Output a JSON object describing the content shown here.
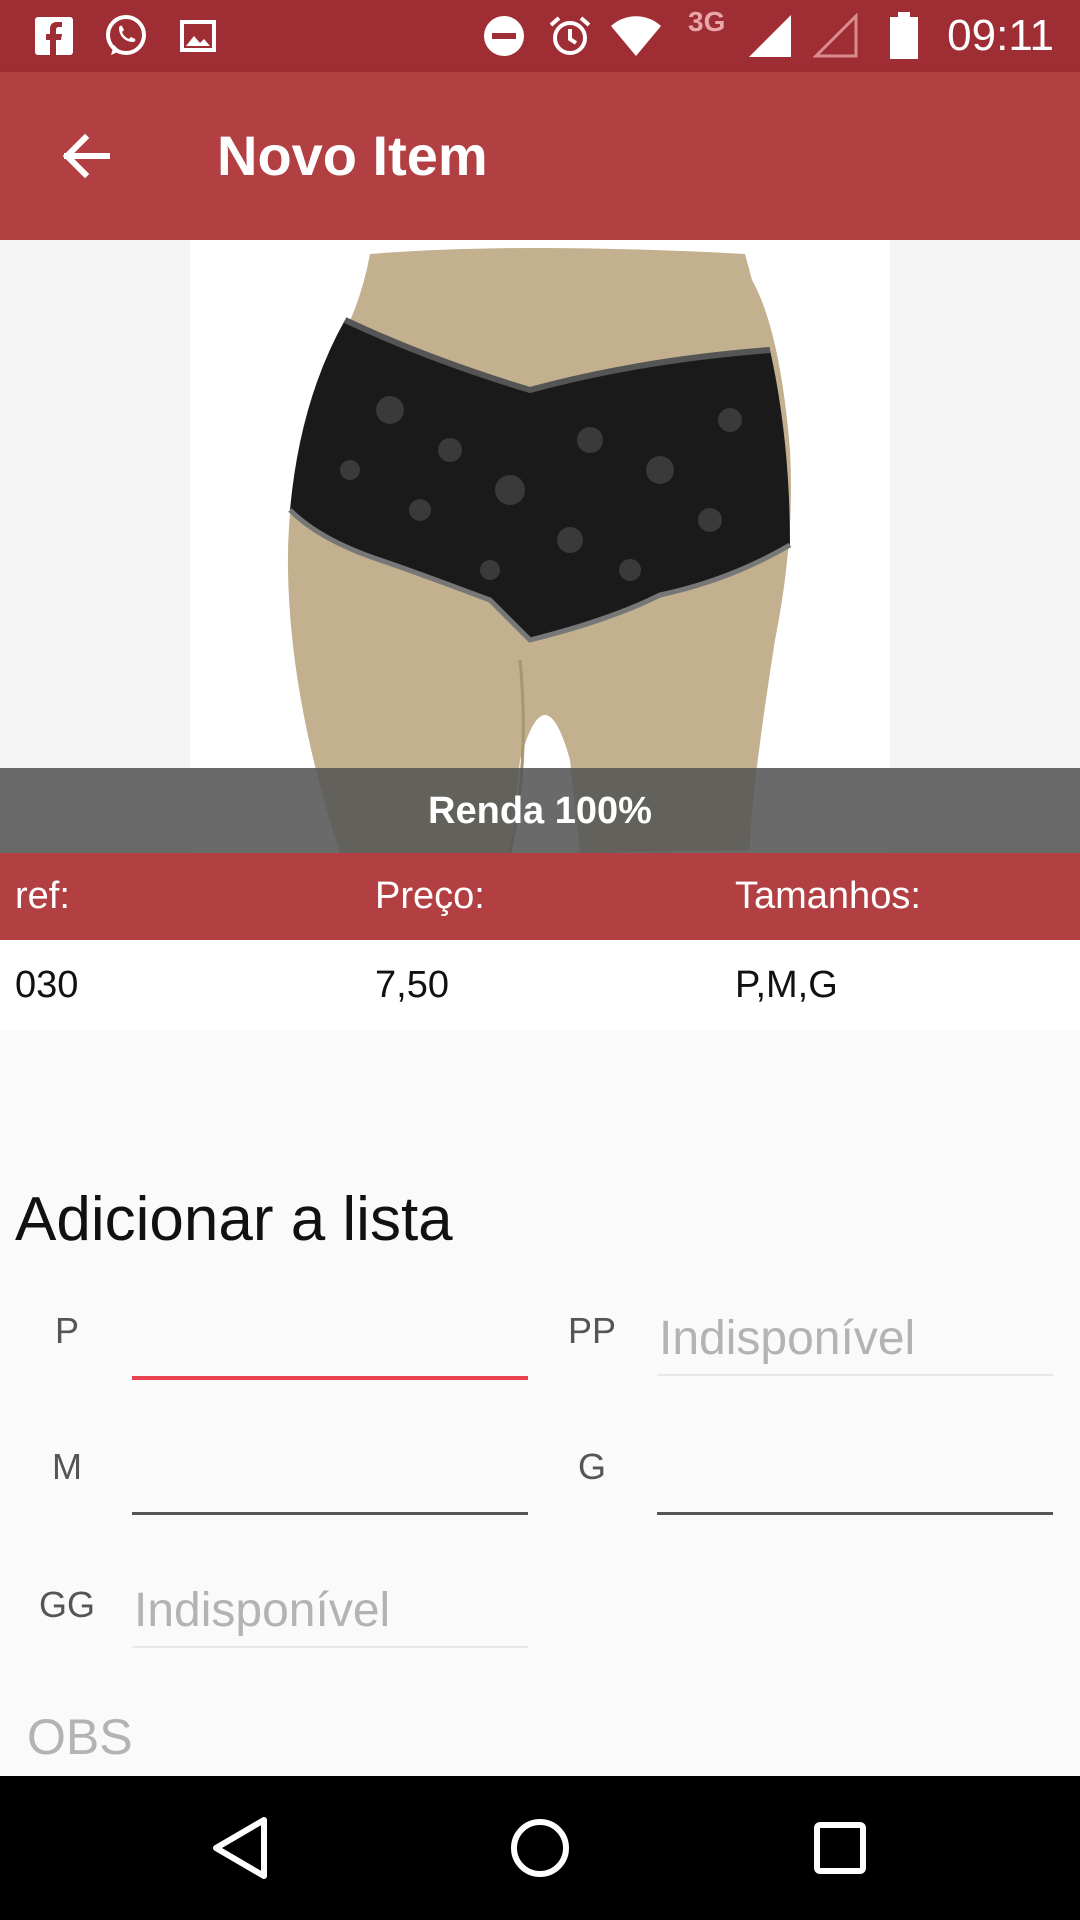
{
  "status_bar": {
    "time": "09:11",
    "network": "3G",
    "icons": [
      "facebook-icon",
      "whatsapp-icon",
      "image-icon",
      "do-not-disturb-icon",
      "alarm-icon",
      "wifi-icon",
      "signal-icon",
      "signal-empty-icon",
      "battery-icon"
    ]
  },
  "app_bar": {
    "title": "Novo Item",
    "back_icon": "arrow-back-icon"
  },
  "product": {
    "caption": "Renda 100%"
  },
  "info": {
    "headers": {
      "ref": "ref:",
      "price": "Preço:",
      "sizes": "Tamanhos:"
    },
    "values": {
      "ref": "030",
      "price": "7,50",
      "sizes": "P,M,G"
    }
  },
  "add_section": {
    "title": "Adicionar a lista",
    "fields": [
      {
        "label": "P",
        "placeholder": ""
      },
      {
        "label": "PP",
        "placeholder": "Indisponível"
      },
      {
        "label": "M",
        "placeholder": ""
      },
      {
        "label": "G",
        "placeholder": ""
      },
      {
        "label": "GG",
        "placeholder": "Indisponível"
      }
    ],
    "obs_placeholder": "OBS"
  },
  "colors": {
    "status_bar": "#9e2e34",
    "app_bar": "#b24043",
    "accent": "#e8414f"
  },
  "nav_bar": {
    "icons": [
      "back-triangle-icon",
      "home-circle-icon",
      "recents-square-icon"
    ]
  }
}
